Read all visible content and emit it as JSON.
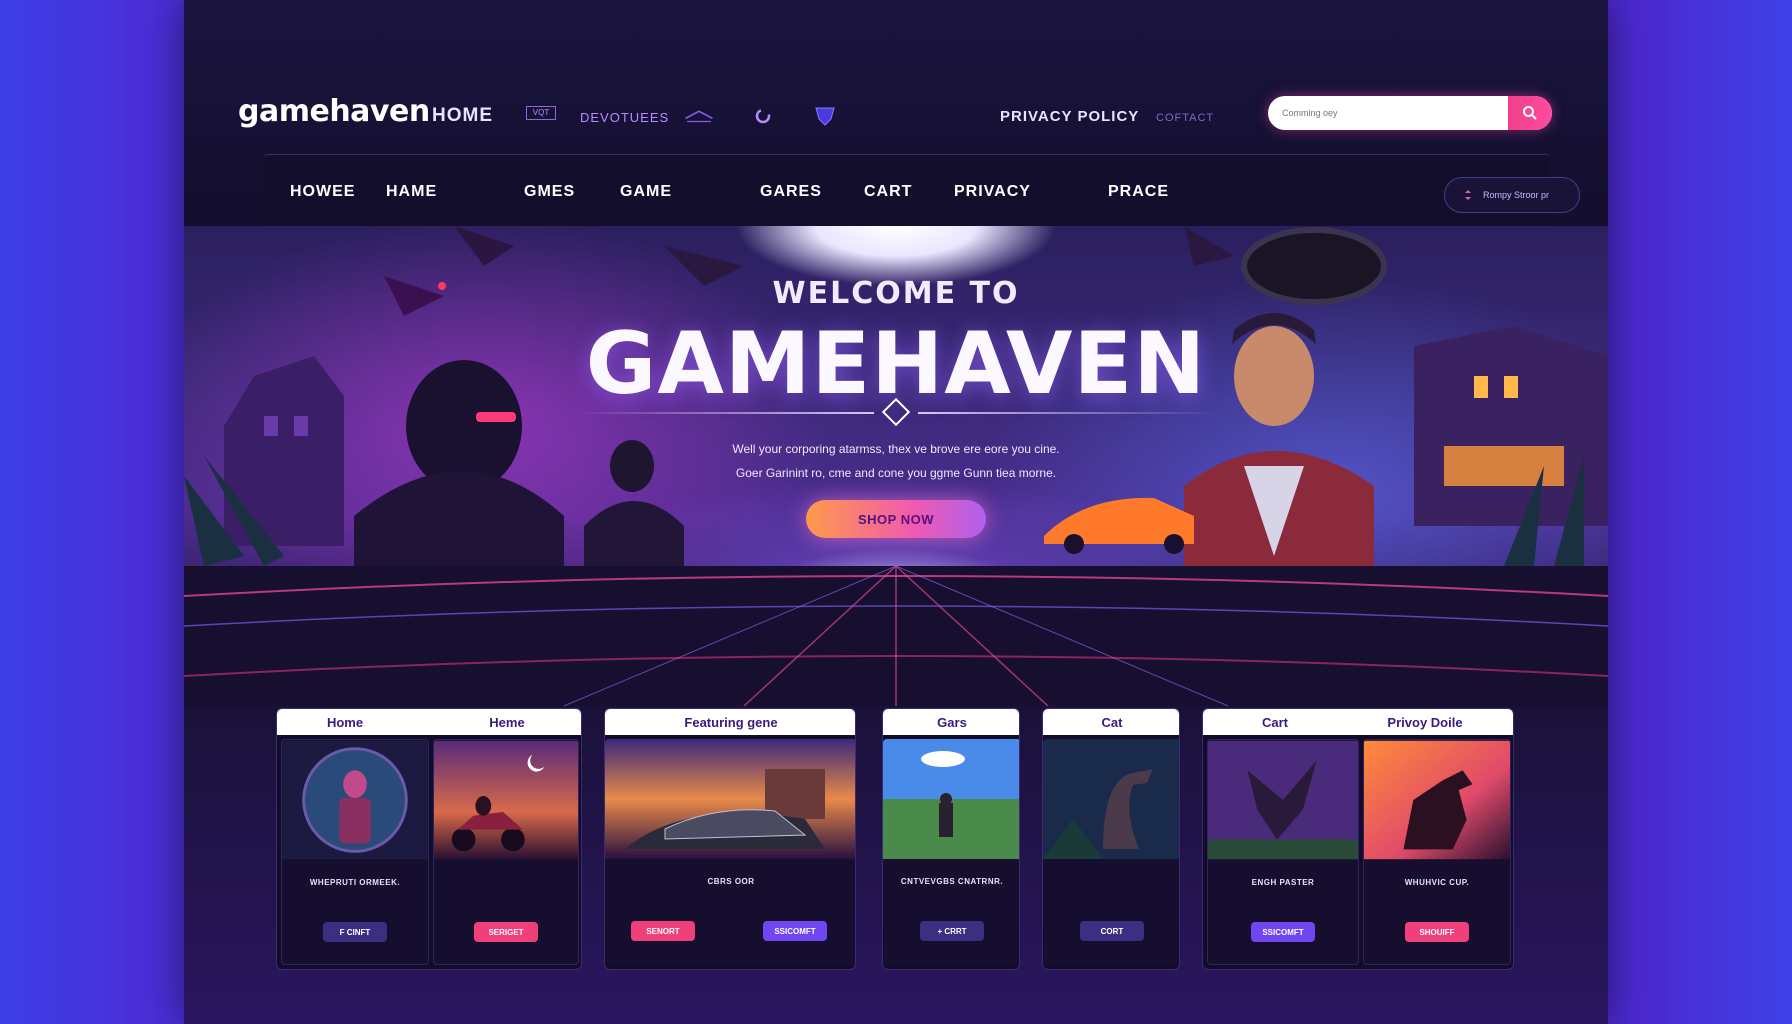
{
  "header": {
    "logo": "gamehaven",
    "links": [
      {
        "label": "HOME",
        "style": "big"
      },
      {
        "label": "VQT",
        "style": "boxed"
      },
      {
        "label": "DEVOTUEES",
        "style": "purple"
      },
      {
        "label": "PRIVACY POLICY",
        "style": "normal"
      },
      {
        "label": "COFTACT",
        "style": "faded"
      }
    ],
    "search": {
      "placeholder": "Comming oey"
    }
  },
  "nav": {
    "items": [
      "HOWEE",
      "HAME",
      "GMES",
      "GAME",
      "GARES",
      "CART",
      "PRIVACY",
      "PRACE"
    ],
    "pill_label": "Rompy Stroor pr"
  },
  "hero": {
    "subtitle": "WELCOME TO",
    "title": "GAMEHAVEN",
    "line1": "Well your corporing atarmss, thex ve brove ere eore you cine.",
    "line2": "Goer Garinint ro, cme and cone you ggme Gunn tiea morne.",
    "cta": "SHOP NOW"
  },
  "card_groups": [
    {
      "headers": [
        "Home",
        "Heme"
      ],
      "cards": [
        {
          "caption": "WHEPRUTI ORMEEK.",
          "button": "F CINFT",
          "color": "#3a2f80",
          "scene": "portrait"
        },
        {
          "caption": "",
          "button": "SERIGET",
          "color": "#f0407a",
          "scene": "moto"
        }
      ]
    },
    {
      "headers": [
        "Featuring gene"
      ],
      "cards": [
        {
          "caption": "CBRS OOR",
          "button": "",
          "color": "#f0407a",
          "scene": "car"
        }
      ],
      "buttons": [
        "SENORT",
        "SSICOMFT"
      ]
    },
    {
      "headers": [
        "Gars"
      ],
      "cards": [
        {
          "caption": "CNTVEVGBS CNATRNR.",
          "button": "+ CRRT",
          "color": "#3a2f80",
          "scene": "field"
        }
      ]
    },
    {
      "headers": [
        "Cat"
      ],
      "cards": [
        {
          "caption": "",
          "button": "CORT",
          "color": "#3a2f80",
          "scene": "dino"
        }
      ]
    },
    {
      "headers": [
        "Cart",
        "Privoy Doile"
      ],
      "cards": [
        {
          "caption": "ENGH PASTER",
          "button": "SSICOMFT",
          "color": "#7046f0",
          "scene": "dragon"
        },
        {
          "caption": "WHUHVIC CUP.",
          "button": "SHOUIFF",
          "color": "#f0407a",
          "scene": "horse"
        }
      ]
    }
  ],
  "colors": {
    "accent_pink": "#f0408c",
    "accent_purple": "#7046f0",
    "background": "#140f2e"
  }
}
